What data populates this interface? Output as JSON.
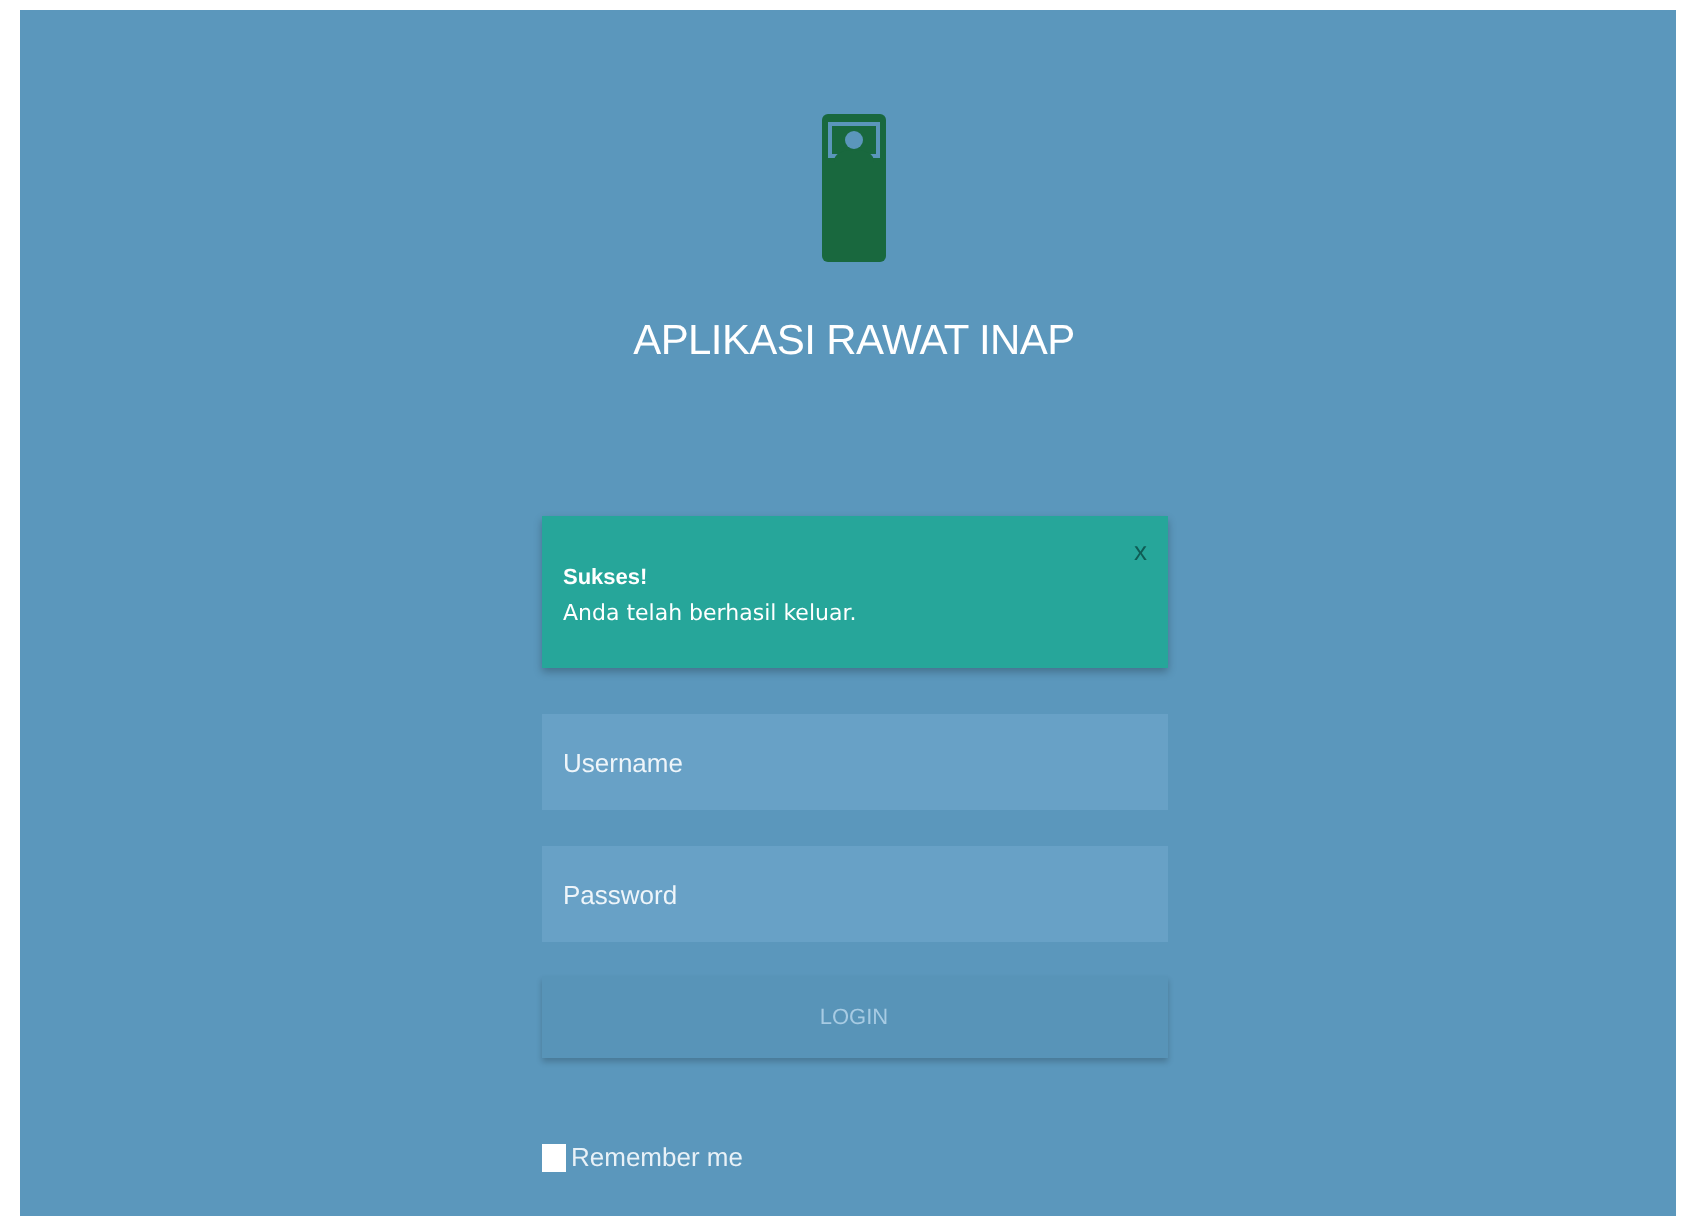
{
  "app_title": "APLIKASI RAWAT INAP",
  "alert": {
    "title": "Sukses!",
    "message": "Anda telah berhasil keluar.",
    "close": "x"
  },
  "fields": [
    {
      "placeholder": "Username"
    },
    {
      "placeholder": "Password"
    }
  ],
  "login_button": "LOGIN",
  "remember": {
    "label": "Remember me",
    "checked": false
  }
}
